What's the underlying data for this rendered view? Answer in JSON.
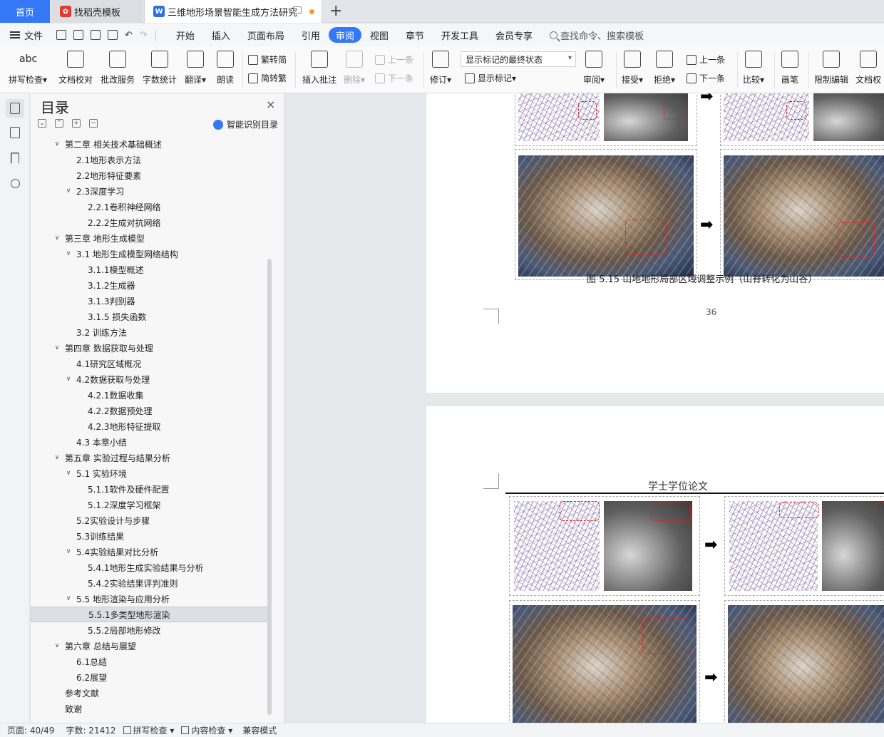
{
  "tabs": {
    "home": "首页",
    "template": "找稻壳模板",
    "document": "三维地形场景智能生成方法研究",
    "add": "+"
  },
  "menubar": {
    "file": "文件",
    "undo": "↶",
    "redo": "↷",
    "items": [
      "开始",
      "插入",
      "页面布局",
      "引用",
      "审阅",
      "视图",
      "章节",
      "开发工具",
      "会员专享"
    ],
    "active": "审阅",
    "search": "查找命令、搜索模板"
  },
  "ribbon": {
    "spell": "拼写检查",
    "proofread": "文档校对",
    "revision_service": "批改服务",
    "word_count": "字数统计",
    "translate": "翻译",
    "read_aloud": "朗读",
    "trad_to_simp": "繁转简",
    "simp_to_trad": "简转繁",
    "insert_comment": "插入批注",
    "delete": "删除",
    "prev": "上一条",
    "next": "下一条",
    "track": "修订",
    "markup_state": "显示标记的最终状态",
    "show_markup": "显示标记",
    "review": "审阅",
    "accept": "接受",
    "reject": "拒绝",
    "prev2": "上一条",
    "next2": "下一条",
    "compare": "比较",
    "pen": "画笔",
    "restrict": "限制编辑",
    "doc_perm": "文档权"
  },
  "toc": {
    "title": "目录",
    "close": "×",
    "smart": "智能识别目录",
    "items": [
      {
        "label": "第二章 相关技术基础概述",
        "level": 1,
        "caret": "∨"
      },
      {
        "label": "2.1地形表示方法",
        "level": 2,
        "caret": ""
      },
      {
        "label": "2.2地形特征要素",
        "level": 2,
        "caret": ""
      },
      {
        "label": "2.3深度学习",
        "level": 2,
        "caret": "∨"
      },
      {
        "label": "2.2.1卷积神经网络",
        "level": 3,
        "caret": ""
      },
      {
        "label": "2.2.2生成对抗网络",
        "level": 3,
        "caret": ""
      },
      {
        "label": "第三章 地形生成模型",
        "level": 1,
        "caret": "∨"
      },
      {
        "label": "3.1 地形生成模型网络结构",
        "level": 2,
        "caret": "∨"
      },
      {
        "label": "3.1.1模型概述",
        "level": 3,
        "caret": ""
      },
      {
        "label": "3.1.2生成器",
        "level": 3,
        "caret": ""
      },
      {
        "label": "3.1.3判别器",
        "level": 3,
        "caret": ""
      },
      {
        "label": "3.1.5 损失函数",
        "level": 3,
        "caret": ""
      },
      {
        "label": "3.2 训练方法",
        "level": 2,
        "caret": ""
      },
      {
        "label": "第四章 数据获取与处理",
        "level": 1,
        "caret": "∨"
      },
      {
        "label": "4.1研究区域概况",
        "level": 2,
        "caret": ""
      },
      {
        "label": "4.2数据获取与处理",
        "level": 2,
        "caret": "∨"
      },
      {
        "label": "4.2.1数据收集",
        "level": 3,
        "caret": ""
      },
      {
        "label": "4.2.2数据预处理",
        "level": 3,
        "caret": ""
      },
      {
        "label": "4.2.3地形特征提取",
        "level": 3,
        "caret": ""
      },
      {
        "label": "4.3 本章小结",
        "level": 2,
        "caret": ""
      },
      {
        "label": "第五章 实验过程与结果分析",
        "level": 1,
        "caret": "∨"
      },
      {
        "label": "5.1 实验环境",
        "level": 2,
        "caret": "∨"
      },
      {
        "label": "5.1.1软件及硬件配置",
        "level": 3,
        "caret": ""
      },
      {
        "label": "5.1.2深度学习框架",
        "level": 3,
        "caret": ""
      },
      {
        "label": "5.2实验设计与步骤",
        "level": 2,
        "caret": ""
      },
      {
        "label": "5.3训练结果",
        "level": 2,
        "caret": ""
      },
      {
        "label": "5.4实验结果对比分析",
        "level": 2,
        "caret": "∨"
      },
      {
        "label": "5.4.1地形生成实验结果与分析",
        "level": 3,
        "caret": ""
      },
      {
        "label": "5.4.2实验结果评判准则",
        "level": 3,
        "caret": ""
      },
      {
        "label": "5.5 地形渲染与应用分析",
        "level": 2,
        "caret": "∨"
      },
      {
        "label": "5.5.1多类型地形渲染",
        "level": 3,
        "caret": "",
        "selected": true
      },
      {
        "label": "5.5.2局部地形修改",
        "level": 3,
        "caret": ""
      },
      {
        "label": "第六章 总结与展望",
        "level": 1,
        "caret": "∨"
      },
      {
        "label": "6.1总结",
        "level": 2,
        "caret": ""
      },
      {
        "label": "6.2展望",
        "level": 2,
        "caret": ""
      },
      {
        "label": "参考文献",
        "level": 1,
        "caret": ""
      },
      {
        "label": "致谢",
        "level": 1,
        "caret": ""
      }
    ]
  },
  "document": {
    "caption": "图 5.15 山地地形局部区域调整示例（山脊转化为山谷）",
    "page_number": "36",
    "header": "学士学位论文",
    "arrow": "➡"
  },
  "status": {
    "page": "页面: 40/49",
    "words": "字数: 21412",
    "spell": "拼写检查",
    "content": "内容检查",
    "compat": "兼容模式"
  }
}
